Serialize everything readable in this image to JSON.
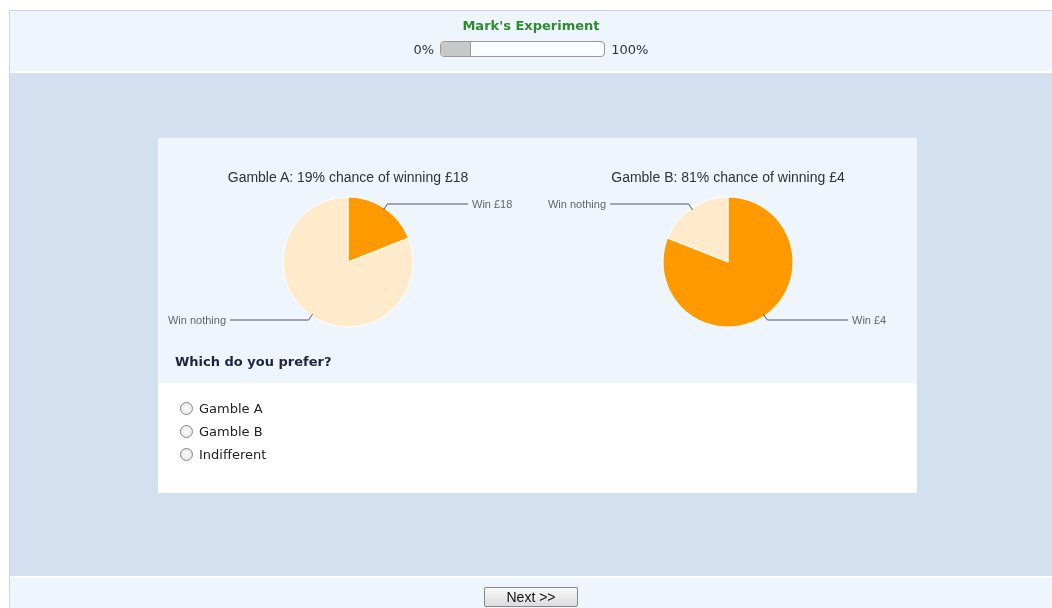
{
  "header": {
    "title": "Mark's Experiment",
    "progress": {
      "start_label": "0%",
      "end_label": "100%",
      "level": 0.18
    }
  },
  "charts": [
    {
      "chart_data": {
        "type": "pie",
        "title": "Gamble A: 19% chance of winning £18",
        "categories": [
          "Win £18",
          "Win nothing"
        ],
        "values": [
          19,
          81
        ]
      }
    },
    {
      "chart_data": {
        "type": "pie",
        "title": "Gamble B: 81% chance of winning £4",
        "categories": [
          "Win £4",
          "Win nothing"
        ],
        "values": [
          81,
          19
        ]
      }
    }
  ],
  "question": "Which do you prefer?",
  "options": [
    {
      "label": "Gamble A",
      "selected": false
    },
    {
      "label": "Gamble B",
      "selected": false
    },
    {
      "label": "Indifferent",
      "selected": false
    }
  ],
  "next_button": "Next >>"
}
